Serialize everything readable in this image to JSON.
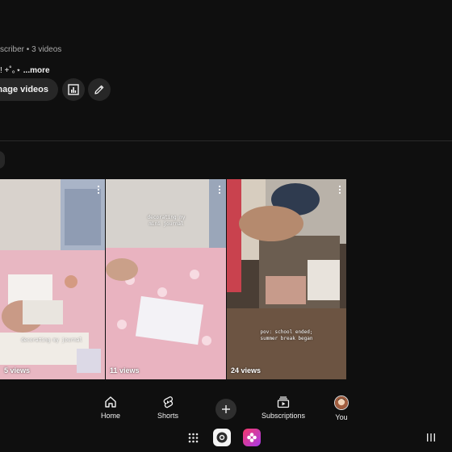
{
  "channel": {
    "meta": "scriber • 3 videos",
    "description": "! +˚｡⋆",
    "description_more": "...more",
    "manage_videos": "anage videos"
  },
  "videos": [
    {
      "views": "5 views",
      "caption": "decorating my journal"
    },
    {
      "views": "11 views",
      "caption": "decorating my mini journal"
    },
    {
      "views": "24 views",
      "caption": "pov: school ended;\nsummer break began"
    }
  ],
  "bottom_nav": {
    "home": "Home",
    "shorts": "Shorts",
    "subscriptions": "Subscriptions",
    "you": "You"
  },
  "icons": [
    "analytics-icon",
    "pencil-icon",
    "more-vert-icon",
    "home-icon",
    "shorts-icon",
    "plus-icon",
    "subscriptions-icon",
    "avatar",
    "app-grid-icon",
    "camera-app-icon",
    "photos-app-icon",
    "recents-icon"
  ],
  "colors": {
    "background": "#0f0f0f",
    "surface": "#272727",
    "text": "#f1f1f1",
    "secondary_text": "#aaaaaa"
  }
}
